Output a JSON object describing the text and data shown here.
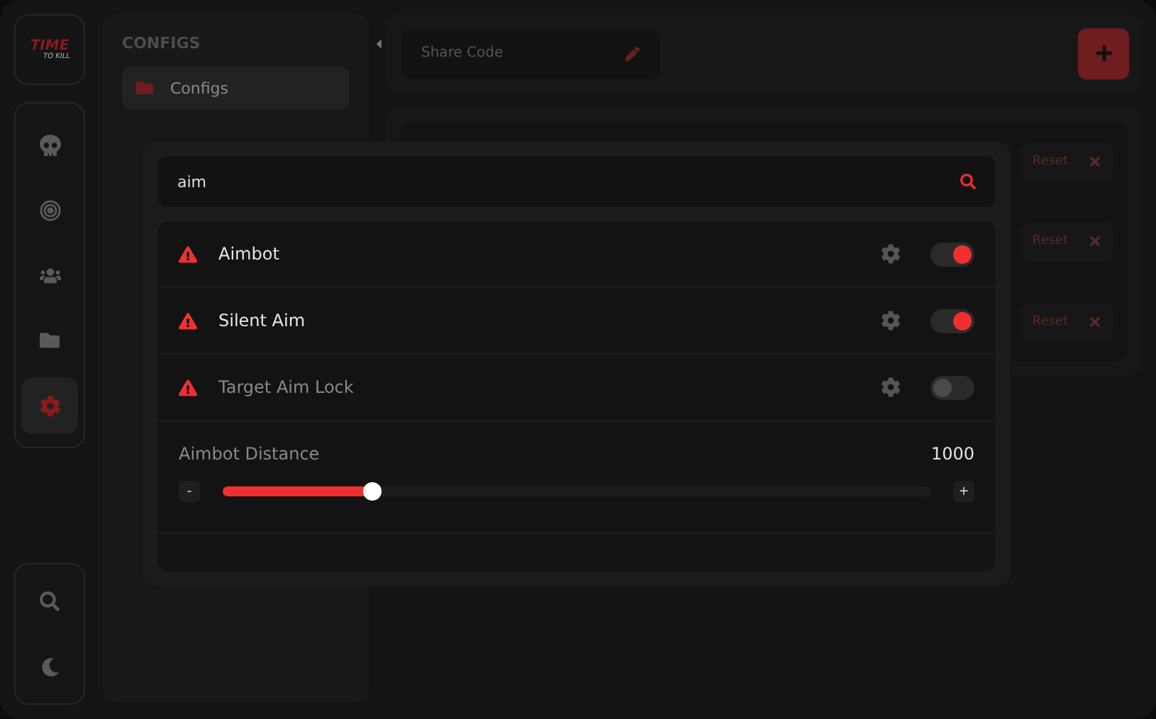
{
  "logo": {
    "title": "TIME",
    "subtitle": "TO KILL"
  },
  "rail": {
    "nav": [
      {
        "kind": "skull",
        "selected": false
      },
      {
        "kind": "target",
        "selected": false
      },
      {
        "kind": "users",
        "selected": false
      },
      {
        "kind": "folder",
        "selected": false
      },
      {
        "kind": "settings",
        "selected": true
      }
    ],
    "bottom": [
      {
        "kind": "search"
      },
      {
        "kind": "moon"
      }
    ]
  },
  "configs_panel": {
    "heading": "CONFIGS",
    "items": [
      {
        "label": "Configs",
        "selected": true
      }
    ]
  },
  "top_bar": {
    "share_code": {
      "placeholder": "Share Code"
    }
  },
  "config_rows": [
    {
      "reset": "Reset"
    },
    {
      "reset": "Reset"
    },
    {
      "reset": "Reset"
    }
  ],
  "search_modal": {
    "search": {
      "value": "aim"
    },
    "features": [
      {
        "label": "Aimbot",
        "on": true
      },
      {
        "label": "Silent Aim",
        "on": true
      },
      {
        "label": "Target Aim Lock",
        "on": false
      }
    ],
    "slider": {
      "label": "Aimbot Distance",
      "reading": "1000",
      "level": 0.21,
      "minus": "-",
      "plus": "+"
    }
  }
}
